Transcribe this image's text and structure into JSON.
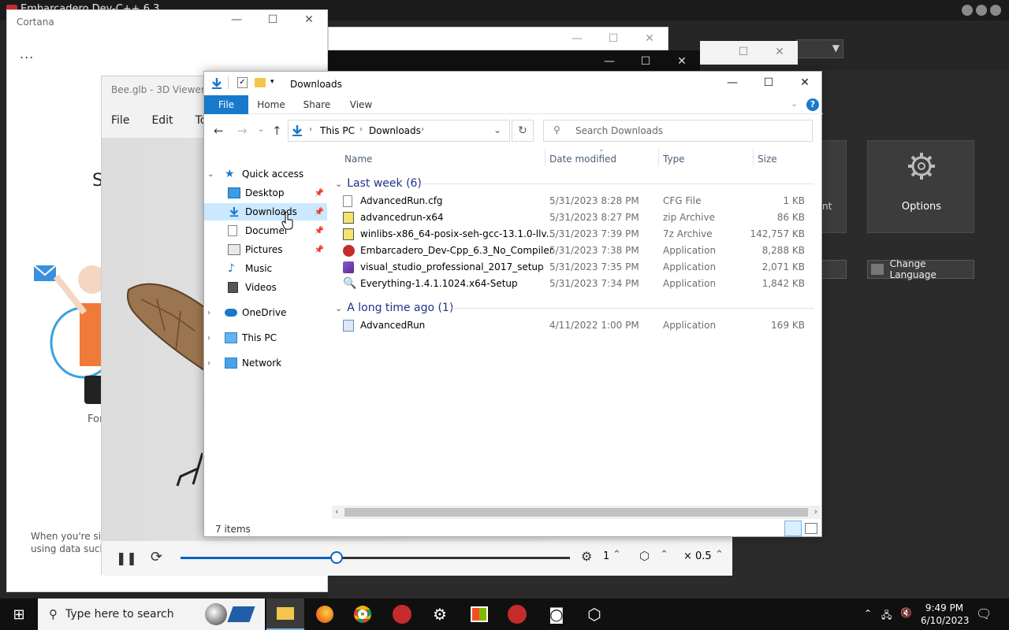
{
  "devcpp": {
    "title": "Embarcadero Dev-C++ 6.3",
    "options_label": "Options",
    "change_language_label": "Change Language",
    "frag_nt": "nt"
  },
  "cortana": {
    "title": "Cortana",
    "more": "...",
    "frag_s": "S",
    "frag_for": "For",
    "frag_when_1": "When you're sign",
    "frag_when_2": "using data such a"
  },
  "viewer": {
    "title": "Bee.glb - 3D Viewer",
    "menu": [
      "File",
      "Edit",
      "Tool"
    ],
    "speed_label": "1",
    "scale_label": "× 0.5",
    "progress": 0.4
  },
  "explorer": {
    "title": "Downloads",
    "tabs": [
      "File",
      "Home",
      "Share",
      "View"
    ],
    "breadcrumb": [
      "This PC",
      "Downloads"
    ],
    "search_placeholder": "Search Downloads",
    "nav": {
      "quick_access": "Quick access",
      "items": [
        {
          "label": "Desktop",
          "pinned": true
        },
        {
          "label": "Downloads",
          "pinned": true
        },
        {
          "label": "Documents",
          "pinned": true
        },
        {
          "label": "Pictures",
          "pinned": true
        },
        {
          "label": "Music",
          "pinned": false
        },
        {
          "label": "Videos",
          "pinned": false
        }
      ],
      "onedrive": "OneDrive",
      "this_pc": "This PC",
      "network": "Network"
    },
    "columns": [
      "Name",
      "Date modified",
      "Type",
      "Size"
    ],
    "groups": [
      {
        "label": "Last week (6)",
        "files": [
          {
            "name": "AdvancedRun.cfg",
            "date": "5/31/2023 8:28 PM",
            "type": "CFG File",
            "size": "1 KB"
          },
          {
            "name": "advancedrun-x64",
            "date": "5/31/2023 8:27 PM",
            "type": "zip Archive",
            "size": "86 KB"
          },
          {
            "name": "winlibs-x86_64-posix-seh-gcc-13.1.0-llv...",
            "date": "5/31/2023 7:39 PM",
            "type": "7z Archive",
            "size": "142,757 KB"
          },
          {
            "name": "Embarcadero_Dev-Cpp_6.3_No_Compiler...",
            "date": "5/31/2023 7:38 PM",
            "type": "Application",
            "size": "8,288 KB"
          },
          {
            "name": "visual_studio_professional_2017_setup",
            "date": "5/31/2023 7:35 PM",
            "type": "Application",
            "size": "2,071 KB"
          },
          {
            "name": "Everything-1.4.1.1024.x64-Setup",
            "date": "5/31/2023 7:34 PM",
            "type": "Application",
            "size": "1,842 KB"
          }
        ]
      },
      {
        "label": "A long time ago (1)",
        "files": [
          {
            "name": "AdvancedRun",
            "date": "4/11/2022 1:00 PM",
            "type": "Application",
            "size": "169 KB"
          }
        ]
      }
    ],
    "status_count": "7 items"
  },
  "taskbar": {
    "search_placeholder": "Type here to search",
    "time": "9:49 PM",
    "date": "6/10/2023"
  },
  "colors": {
    "accent": "#1979ca",
    "selected": "#cce8ff",
    "folder": "#f3c54f"
  }
}
